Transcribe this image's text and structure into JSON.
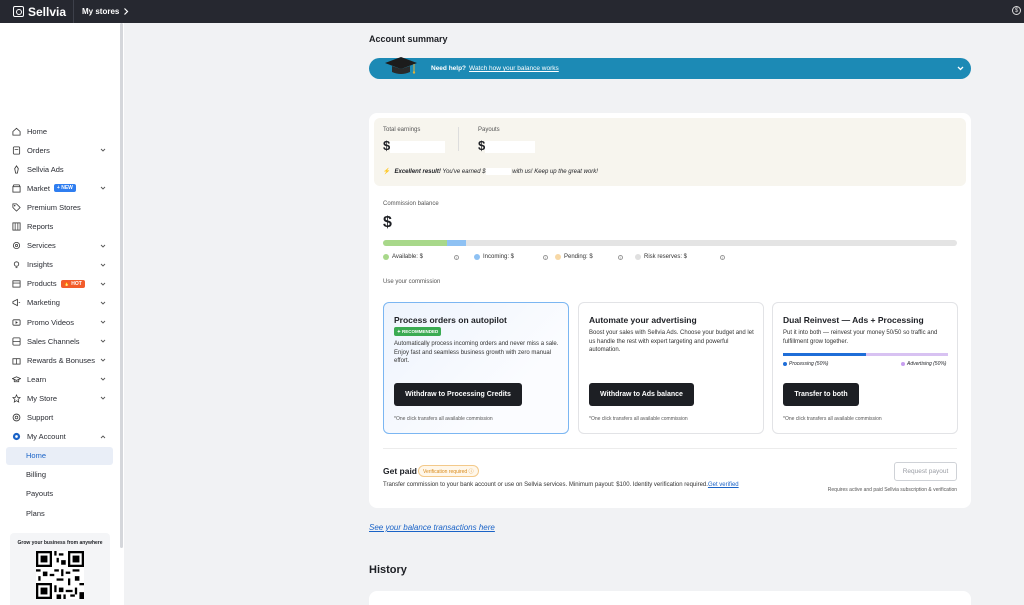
{
  "topbar": {
    "brand": "Sellvia",
    "my_stores": "My stores"
  },
  "sidebar": {
    "items": [
      {
        "label": "Home",
        "icon": "home-icon"
      },
      {
        "label": "Orders",
        "icon": "orders-icon",
        "expandable": true
      },
      {
        "label": "Sellvia Ads",
        "icon": "ads-icon"
      },
      {
        "label": "Market",
        "icon": "market-icon",
        "badge": "NEW",
        "expandable": true
      },
      {
        "label": "Premium Stores",
        "icon": "tag-icon"
      },
      {
        "label": "Reports",
        "icon": "reports-icon"
      },
      {
        "label": "Services",
        "icon": "services-icon",
        "expandable": true
      },
      {
        "label": "Insights",
        "icon": "insights-icon",
        "expandable": true
      },
      {
        "label": "Products",
        "icon": "products-icon",
        "badge": "HOT",
        "expandable": true
      },
      {
        "label": "Marketing",
        "icon": "marketing-icon",
        "expandable": true
      },
      {
        "label": "Promo Videos",
        "icon": "video-icon",
        "expandable": true
      },
      {
        "label": "Sales Channels",
        "icon": "channels-icon",
        "expandable": true
      },
      {
        "label": "Rewards & Bonuses",
        "icon": "rewards-icon",
        "expandable": true
      },
      {
        "label": "Learn",
        "icon": "learn-icon",
        "expandable": true
      },
      {
        "label": "My Store",
        "icon": "star-icon",
        "expandable": true
      },
      {
        "label": "Support",
        "icon": "support-icon"
      },
      {
        "label": "My Account",
        "icon": "account-icon",
        "expanded": true
      }
    ],
    "sub_items": [
      {
        "label": "Home",
        "active": true
      },
      {
        "label": "Billing"
      },
      {
        "label": "Payouts"
      },
      {
        "label": "Plans"
      }
    ],
    "qr_card_title": "Grow your business from anywhere"
  },
  "main": {
    "title": "Account summary",
    "help": {
      "label": "Need help?",
      "link": "Watch how your balance works"
    },
    "earnings": {
      "total_label": "Total earnings",
      "total_value": "$",
      "payouts_label": "Payouts",
      "payouts_value": "$",
      "note_bold": "Excellent result!",
      "note_pre": " You've earned $",
      "note_post": " with us! Keep up the great work!"
    },
    "commission": {
      "label": "Commission balance",
      "value": "$",
      "bar": {
        "available": 0.112,
        "incoming": 0.032,
        "pending": 0.0,
        "colors": {
          "available": "#a8d88a",
          "incoming": "#8ec1f3",
          "pending": "#f7d8a6",
          "risk": "#e4e4e4"
        }
      },
      "legend": {
        "available": "Available: $",
        "incoming": "Incoming: $",
        "pending": "Pending: $",
        "risk": "Risk reserves: $"
      }
    },
    "use_label": "Use your commission",
    "options": [
      {
        "title": "Process orders on autopilot",
        "badge": "RECOMMENDED",
        "desc": "Automatically process incoming orders and never miss a sale. Enjoy fast and seamless business growth with zero manual effort.",
        "button": "Withdraw to Processing Credits",
        "foot": "*One click transfers all available commission"
      },
      {
        "title": "Automate your advertising",
        "desc": "Boost your sales with Sellvia Ads. Choose your budget and let us handle the rest with expert targeting and powerful automation.",
        "button": "Withdraw to Ads balance",
        "foot": "*One click transfers all available commission"
      },
      {
        "title": "Dual Reinvest — Ads + Processing",
        "desc": "Put it into both — reinvest your money 50/50 so traffic and fulfillment grow together.",
        "split_a": "Processing (50%)",
        "split_b": "Advertising (50%)",
        "split_ratio": 0.5,
        "button": "Transfer to both",
        "foot": "*One click transfers all available commission"
      }
    ],
    "get_paid": {
      "title": "Get paid",
      "badge": "Verification required",
      "desc": "Transfer commission to your bank account or use on Sellvia services. Minimum payout: $100. Identity verification required.",
      "link": "Get verified",
      "button": "Request payout",
      "note": "Requires active and paid Sellvia subscription & verification"
    },
    "transactions_link": "See your balance transactions here",
    "history_title": "History"
  }
}
